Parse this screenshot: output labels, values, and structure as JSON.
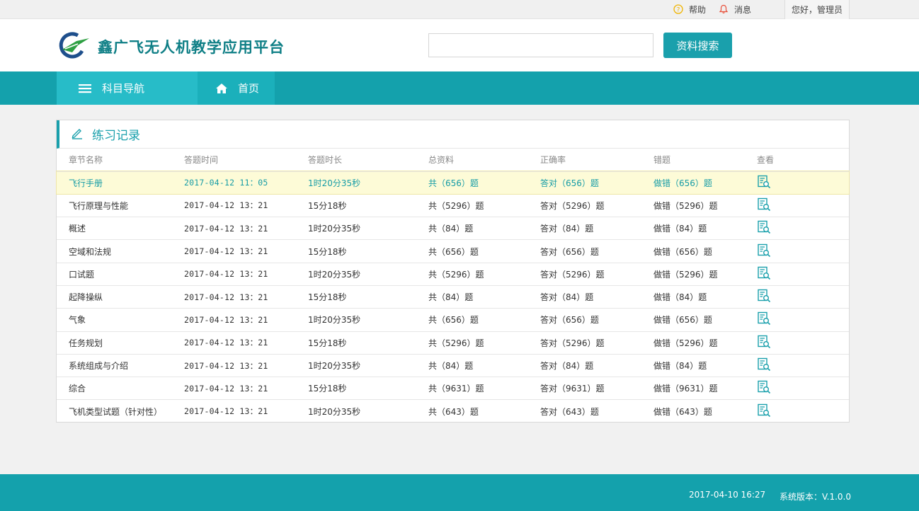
{
  "topbar": {
    "help": "帮助",
    "messages": "消息",
    "greeting": "您好，管理员"
  },
  "header": {
    "logo_title": "鑫广飞无人机教学应用平台",
    "search_placeholder": "",
    "search_button": "资料搜索"
  },
  "nav": {
    "subjects": "科目导航",
    "home": "首页"
  },
  "panel": {
    "title": "练习记录",
    "columns": [
      "章节名称",
      "答题时间",
      "答题时长",
      "总资料",
      "正确率",
      "错题",
      "查看"
    ],
    "rows": [
      {
        "name": "飞行手册",
        "time": "2017-04-12  11：05",
        "duration": "1时20分35秒",
        "total": "共（656）题",
        "correct": "答对（656）题",
        "wrong": "做错（656）题",
        "highlight": true
      },
      {
        "name": "飞行原理与性能",
        "time": "2017-04-12  13：21",
        "duration": "15分18秒",
        "total": "共（5296）题",
        "correct": "答对（5296）题",
        "wrong": "做错（5296）题"
      },
      {
        "name": "概述",
        "time": "2017-04-12  13：21",
        "duration": "1时20分35秒",
        "total": "共（84）题",
        "correct": "答对（84）题",
        "wrong": "做错（84）题"
      },
      {
        "name": "空域和法规",
        "time": "2017-04-12  13：21",
        "duration": "15分18秒",
        "total": "共（656）题",
        "correct": "答对（656）题",
        "wrong": "做错（656）题"
      },
      {
        "name": "口试题",
        "time": "2017-04-12  13：21",
        "duration": "1时20分35秒",
        "total": "共（5296）题",
        "correct": "答对（5296）题",
        "wrong": "做错（5296）题"
      },
      {
        "name": "起降操纵",
        "time": "2017-04-12  13：21",
        "duration": "15分18秒",
        "total": "共（84）题",
        "correct": "答对（84）题",
        "wrong": "做错（84）题"
      },
      {
        "name": "气象",
        "time": "2017-04-12  13：21",
        "duration": "1时20分35秒",
        "total": "共（656）题",
        "correct": "答对（656）题",
        "wrong": "做错（656）题"
      },
      {
        "name": "任务规划",
        "time": "2017-04-12  13：21",
        "duration": "15分18秒",
        "total": "共（5296）题",
        "correct": "答对（5296）题",
        "wrong": "做错（5296）题"
      },
      {
        "name": "系统组成与介绍",
        "time": "2017-04-12  13：21",
        "duration": "1时20分35秒",
        "total": "共（84）题",
        "correct": "答对（84）题",
        "wrong": "做错（84）题"
      },
      {
        "name": "综合",
        "time": "2017-04-12  13：21",
        "duration": "15分18秒",
        "total": "共（9631）题",
        "correct": "答对（9631）题",
        "wrong": "做错（9631）题"
      },
      {
        "name": "飞机类型试题（针对性）",
        "time": "2017-04-12  13：21",
        "duration": "1时20分35秒",
        "total": "共（643）题",
        "correct": "答对（643）题",
        "wrong": "做错（643）题"
      }
    ]
  },
  "footer": {
    "date": "2017-04-10  16:27",
    "version": "系统版本：V.1.0.0"
  },
  "colors": {
    "brand": "#14a1ac",
    "nav_active": "#27bcc8",
    "highlight_row": "#fdfbd7",
    "help_icon": "#f0b400",
    "bell_icon": "#e8503a"
  },
  "icons": [
    "help-icon",
    "bell-icon",
    "logo-icon",
    "menu-icon",
    "home-icon",
    "edit-icon",
    "view-record-icon"
  ]
}
